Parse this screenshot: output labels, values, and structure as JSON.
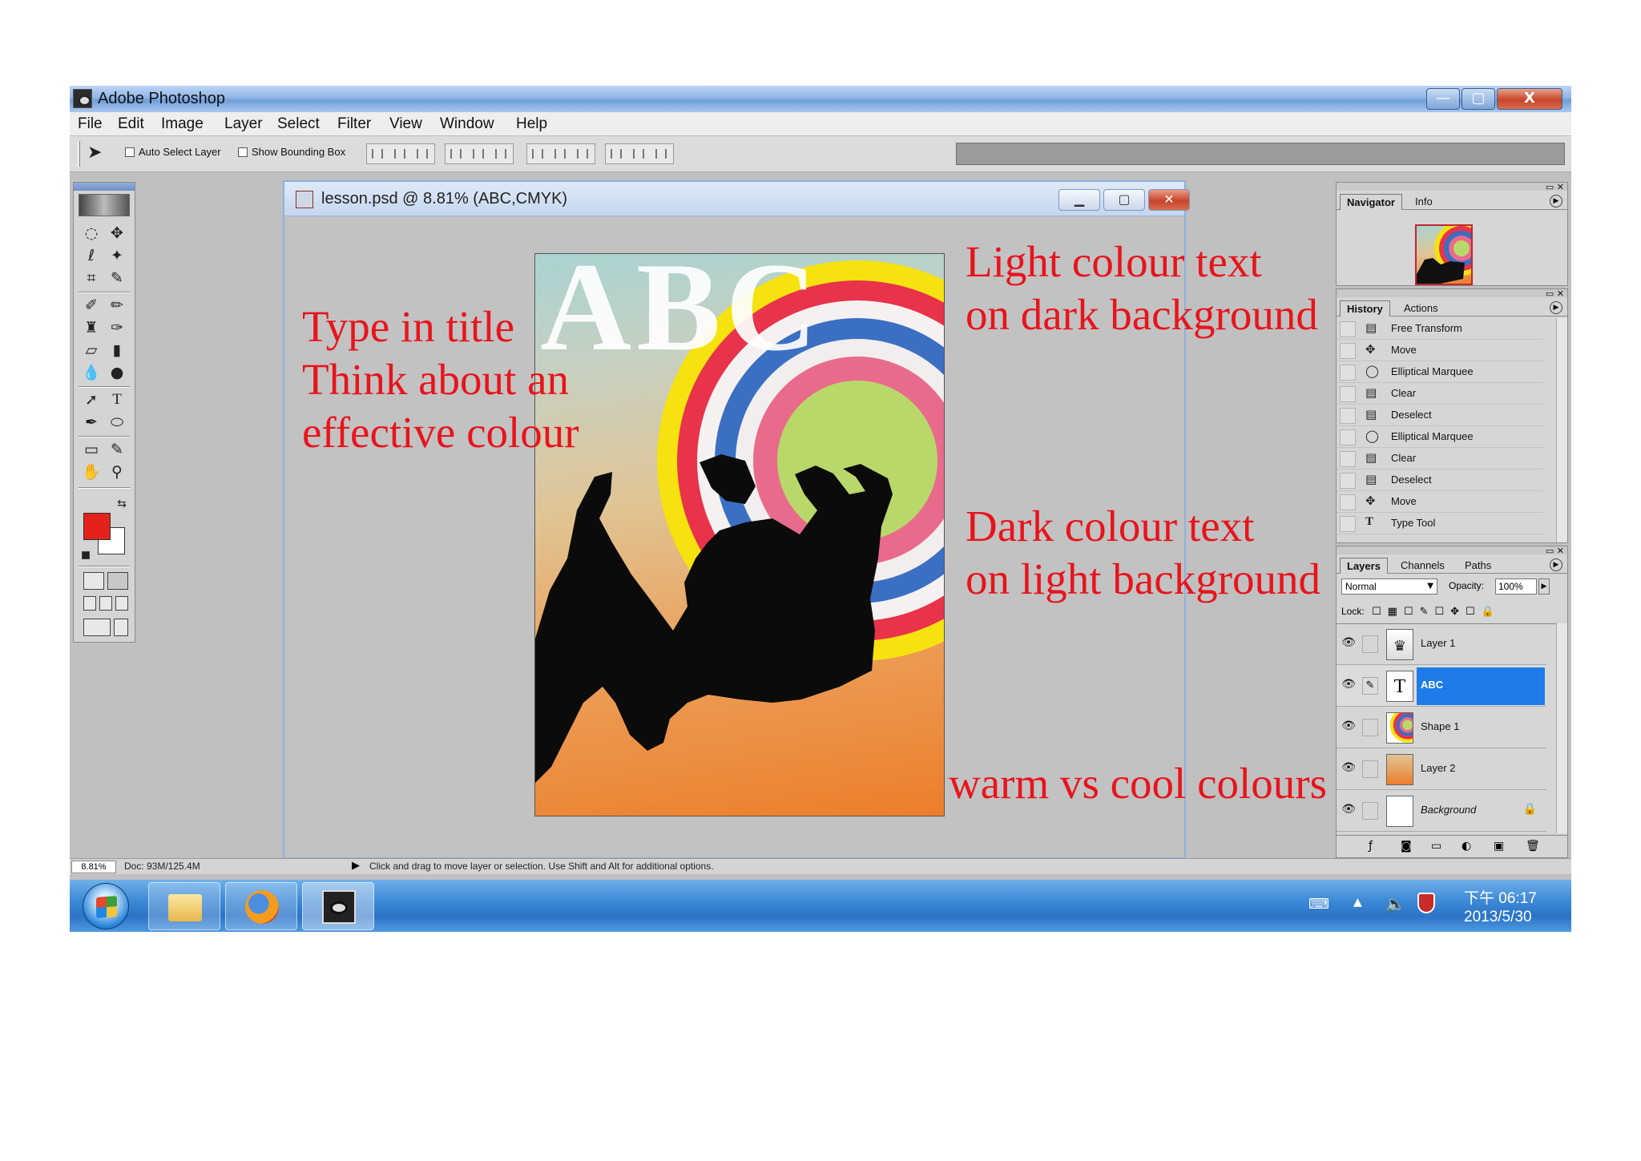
{
  "window": {
    "title": "Adobe Photoshop",
    "min": "—",
    "max": "▢",
    "close": "X"
  },
  "menu": [
    "File",
    "Edit",
    "Image",
    "Layer",
    "Select",
    "Filter",
    "View",
    "Window",
    "Help"
  ],
  "options": {
    "auto_select": "Auto Select Layer",
    "show_bbox": "Show Bounding Box"
  },
  "document": {
    "title": "lesson.psd @ 8.81% (ABC,CMYK)",
    "poster_title": "ABC",
    "colors": {
      "bg_top": "#a9d3d2",
      "bg_bottom": "#ec7e2a",
      "ring_yellow": "#f6e20f",
      "ring_red": "#e8334a",
      "ring_blue": "#3b6fc2",
      "ring_pink": "#e96b8b",
      "center": "#b8d96a"
    }
  },
  "annotations": {
    "left": [
      "Type in title",
      "Think about an",
      "effective colour"
    ],
    "top_right": [
      "Light colour text",
      "on dark background"
    ],
    "mid_right": [
      "Dark colour text",
      "on light background"
    ],
    "bottom_right": "warm vs cool colours"
  },
  "navigator": {
    "tabs": [
      "Navigator",
      "Info"
    ]
  },
  "history": {
    "tabs": [
      "History",
      "Actions"
    ],
    "items": [
      {
        "icon": "doc-icon",
        "label": "Free Transform"
      },
      {
        "icon": "move-icon",
        "label": "Move"
      },
      {
        "icon": "elliptical-marquee-icon",
        "label": "Elliptical Marquee"
      },
      {
        "icon": "doc-icon",
        "label": "Clear"
      },
      {
        "icon": "doc-icon",
        "label": "Deselect"
      },
      {
        "icon": "elliptical-marquee-icon",
        "label": "Elliptical Marquee"
      },
      {
        "icon": "doc-icon",
        "label": "Clear"
      },
      {
        "icon": "doc-icon",
        "label": "Deselect"
      },
      {
        "icon": "move-icon",
        "label": "Move"
      },
      {
        "icon": "type-tool-icon",
        "label": "Type Tool"
      }
    ]
  },
  "layers_panel": {
    "tabs": [
      "Layers",
      "Channels",
      "Paths"
    ],
    "blend_mode": "Normal",
    "opacity_label": "Opacity:",
    "opacity_value": "100%",
    "lock_label": "Lock:",
    "layers": [
      {
        "name": "Layer 1",
        "thumb": "figure",
        "selected": false
      },
      {
        "name": "ABC",
        "thumb": "T",
        "selected": true
      },
      {
        "name": "Shape 1",
        "thumb": "rings",
        "selected": false
      },
      {
        "name": "Layer 2",
        "thumb": "gradient",
        "selected": false
      },
      {
        "name": "Background",
        "thumb": "white",
        "selected": false,
        "locked": true
      }
    ]
  },
  "status": {
    "zoom": "8.81%",
    "doc": "Doc: 93M/125.4M",
    "hint": "Click and drag to move layer or selection.  Use Shift and Alt for additional options."
  },
  "taskbar": {
    "time": "下午 06:17",
    "date": "2013/5/30"
  }
}
